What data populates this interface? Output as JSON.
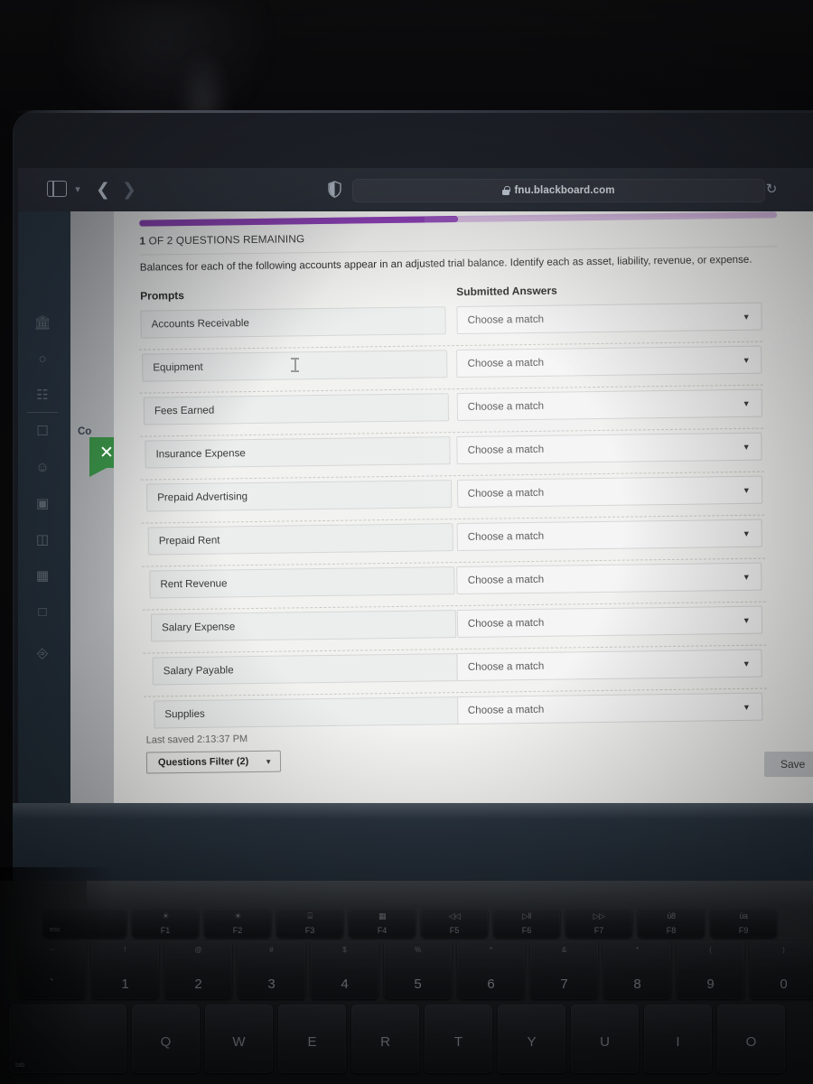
{
  "browser": {
    "url": "fnu.blackboard.com",
    "icons": {
      "sidebar_toggle": "sidebar-toggle-icon",
      "chevron_down": "chevron-down-icon",
      "back": "back-arrow-icon",
      "forward": "forward-arrow-icon",
      "shield": "privacy-shield-icon",
      "lock": "lock-icon",
      "reload": "reload-icon"
    }
  },
  "sidebar": {
    "partial_label": "Co",
    "close_badge": "✕",
    "icons": [
      "institution-icon",
      "profile-icon",
      "globe-icon",
      "messages-icon",
      "groups-icon",
      "calendar-icon",
      "grades-icon",
      "courses-icon",
      "tools-icon",
      "signout-icon"
    ]
  },
  "assessment": {
    "progress_percent": 50,
    "progress_colors": {
      "fill": "#8a3fb3",
      "track": "#d3b6de"
    },
    "remaining_count": "1",
    "remaining_suffix": " OF 2 QUESTIONS REMAINING",
    "question_text": "Balances for each of the following accounts appear in an adjusted trial balance. Identify each as asset, liability, revenue, or expense.",
    "columns": {
      "prompts": "Prompts",
      "answers": "Submitted Answers"
    },
    "match_placeholder": "Choose a match",
    "prompts": [
      "Accounts Receivable",
      "Equipment",
      "Fees Earned",
      "Insurance Expense",
      "Prepaid Advertising",
      "Prepaid Rent",
      "Rent Revenue",
      "Salary Expense",
      "Salary Payable",
      "Supplies"
    ],
    "last_saved": "Last saved 2:13:37 PM",
    "questions_filter": "Questions Filter (2)",
    "save_label": "Save"
  },
  "keyboard": {
    "fn_row": [
      {
        "label": "esc",
        "fn": ""
      },
      {
        "label": "",
        "fn": "F1",
        "icon": "☀"
      },
      {
        "label": "",
        "fn": "F2",
        "icon": "☀"
      },
      {
        "label": "",
        "fn": "F3",
        "icon": "⌸"
      },
      {
        "label": "",
        "fn": "F4",
        "icon": "▦"
      },
      {
        "label": "",
        "fn": "F5",
        "icon": "◁◁"
      },
      {
        "label": "",
        "fn": "F6",
        "icon": "▷‖"
      },
      {
        "label": "",
        "fn": "F7",
        "icon": "▷▷"
      },
      {
        "label": "",
        "fn": "F8",
        "icon": "ὐ8"
      },
      {
        "label": "",
        "fn": "F9",
        "icon": "ὐa"
      }
    ],
    "number_row": [
      {
        "upper": "~",
        "lower": "`"
      },
      {
        "upper": "!",
        "lower": "1"
      },
      {
        "upper": "@",
        "lower": "2"
      },
      {
        "upper": "#",
        "lower": "3"
      },
      {
        "upper": "$",
        "lower": "4"
      },
      {
        "upper": "%",
        "lower": "5"
      },
      {
        "upper": "^",
        "lower": "6"
      },
      {
        "upper": "&",
        "lower": "7"
      },
      {
        "upper": "*",
        "lower": "8"
      },
      {
        "upper": "(",
        "lower": "9"
      },
      {
        "upper": ")",
        "lower": "0"
      }
    ],
    "letter_row": [
      "Q",
      "W",
      "E",
      "R",
      "T",
      "Y",
      "U",
      "I",
      "O"
    ],
    "tab_label": "tab"
  }
}
